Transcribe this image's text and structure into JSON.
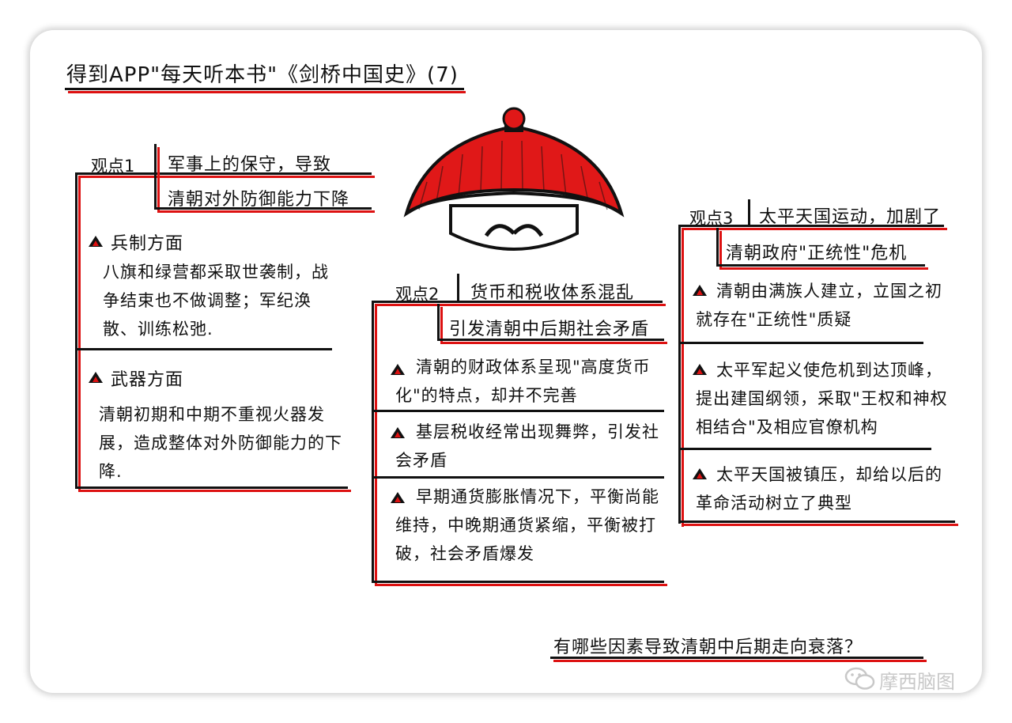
{
  "title": "得到APP\"每天听本书\"《剑桥中国史》(7)",
  "view1": {
    "label": "观点1",
    "heading_line1": "军事上的保守，导致",
    "heading_line2": "清朝对外防御能力下降",
    "items": [
      {
        "title": "兵制方面",
        "text": "八旗和绿营都采取世袭制，战争结束也不做调整；军纪涣散、训练松弛."
      },
      {
        "title": "武器方面",
        "text": "清朝初期和中期不重视火器发展，造成整体对外防御能力的下降."
      }
    ]
  },
  "view2": {
    "label": "观点2",
    "heading_line1": "货币和税收体系混乱",
    "heading_line2": "引发清朝中后期社会矛盾",
    "items": [
      {
        "text": "清朝的财政体系呈现\"高度货币化\"的特点，却并不完善"
      },
      {
        "text": "基层税收经常出现舞弊，引发社会矛盾"
      },
      {
        "text": "早期通货膨胀情况下，平衡尚能维持，中晚期通货紧缩，平衡被打破，社会矛盾爆发"
      }
    ]
  },
  "view3": {
    "label": "观点3",
    "heading_line1": "太平天国运动，加剧了",
    "heading_line2": "清朝政府\"正统性\"危机",
    "items": [
      {
        "text": "清朝由满族人建立，立国之初就存在\"正统性\"质疑"
      },
      {
        "text": "太平军起义使危机到达顶峰，提出建国纲领，采取\"王权和神权相结合\"及相应官僚机构"
      },
      {
        "text": "太平天国被镇压，却给以后的革命活动树立了典型"
      }
    ]
  },
  "footer_question": "有哪些因素导致清朝中后期走向衰落？",
  "watermark": "摩西脑图",
  "colors": {
    "accent_red": "#dd1111",
    "ink": "#111111"
  },
  "icons": [
    "qing-hat-icon",
    "triangle-bullet-icon",
    "wechat-icon"
  ]
}
